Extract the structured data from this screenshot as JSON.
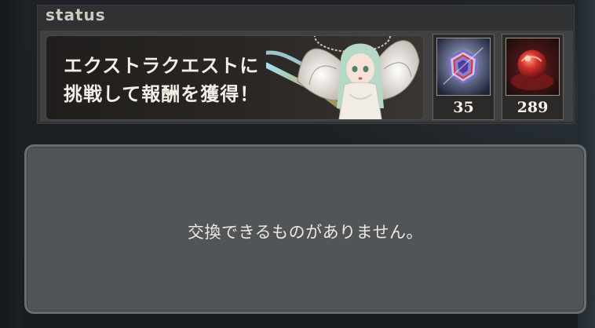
{
  "status": {
    "title": "status"
  },
  "banner": {
    "line1": "エクストラクエストに",
    "line2": "挑戦して報酬を獲得！"
  },
  "items": [
    {
      "icon": "crystal-shield-icon",
      "count": "35",
      "accent": "#7d6cc9"
    },
    {
      "icon": "red-orb-icon",
      "count": "289",
      "accent": "#c0282a"
    }
  ],
  "message": {
    "text": "交換できるものがありません。"
  }
}
